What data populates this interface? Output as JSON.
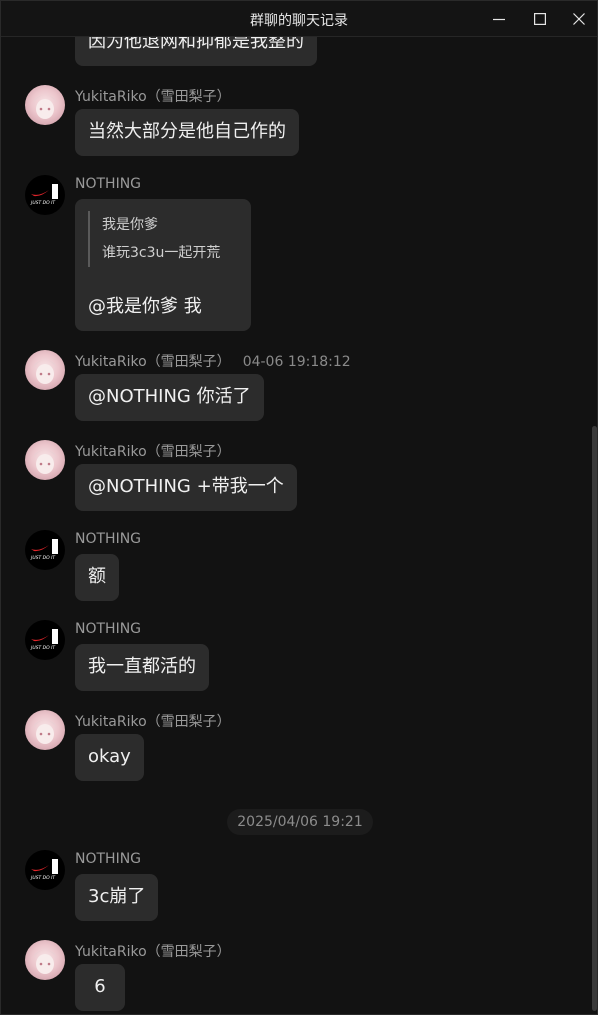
{
  "window": {
    "title": "群聊的聊天记录",
    "buttons": {
      "minimize": "minimize-icon",
      "maximize": "maximize-icon",
      "close": "close-icon"
    }
  },
  "date_divider": "2025/04/06 19:21",
  "messages": [
    {
      "sender": "",
      "avatar": "none",
      "text": "因为他退网和抑郁是我整的"
    },
    {
      "sender": "YukitaRiko（雪田梨子）",
      "avatar": "anime-girl-avatar",
      "text": "当然大部分是他自己作的"
    },
    {
      "sender": "NOTHING",
      "avatar": "nike-just-do-it-avatar",
      "quote": {
        "author": "我是你爹",
        "text": "谁玩3c3u一起开荒"
      },
      "text": "@我是你爹 我"
    },
    {
      "sender": "YukitaRiko（雪田梨子）",
      "time": "04-06 19:18:12",
      "avatar": "anime-girl-avatar",
      "text": "@NOTHING 你活了"
    },
    {
      "sender": "YukitaRiko（雪田梨子）",
      "avatar": "anime-girl-avatar",
      "text": "@NOTHING +带我一个"
    },
    {
      "sender": "NOTHING",
      "avatar": "nike-just-do-it-avatar",
      "text": "额"
    },
    {
      "sender": "NOTHING",
      "avatar": "nike-just-do-it-avatar",
      "text": "我一直都活的"
    },
    {
      "sender": "YukitaRiko（雪田梨子）",
      "avatar": "anime-girl-avatar",
      "text": "okay"
    },
    {
      "sender": "NOTHING",
      "avatar": "nike-just-do-it-avatar",
      "text": "3c崩了"
    },
    {
      "sender": "YukitaRiko（雪田梨子）",
      "avatar": "anime-girl-avatar",
      "text": "6"
    }
  ],
  "logo_text": "JUST DO IT"
}
